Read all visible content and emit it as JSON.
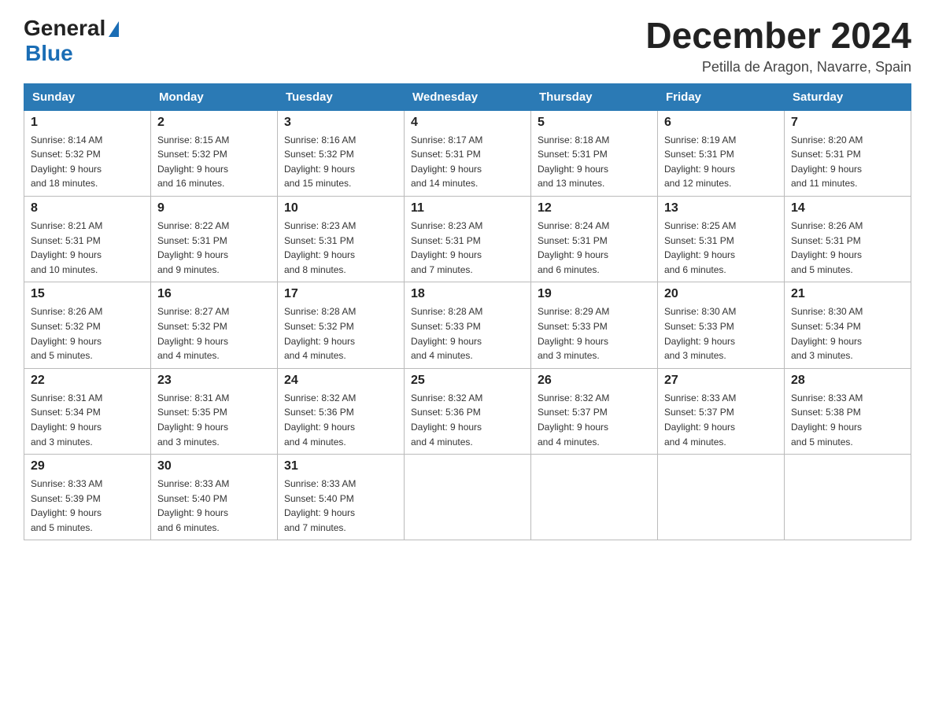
{
  "header": {
    "logo_general": "General",
    "logo_blue": "Blue",
    "month_title": "December 2024",
    "location": "Petilla de Aragon, Navarre, Spain"
  },
  "weekdays": [
    "Sunday",
    "Monday",
    "Tuesday",
    "Wednesday",
    "Thursday",
    "Friday",
    "Saturday"
  ],
  "weeks": [
    [
      {
        "day": "1",
        "sunrise": "8:14 AM",
        "sunset": "5:32 PM",
        "daylight": "9 hours and 18 minutes."
      },
      {
        "day": "2",
        "sunrise": "8:15 AM",
        "sunset": "5:32 PM",
        "daylight": "9 hours and 16 minutes."
      },
      {
        "day": "3",
        "sunrise": "8:16 AM",
        "sunset": "5:32 PM",
        "daylight": "9 hours and 15 minutes."
      },
      {
        "day": "4",
        "sunrise": "8:17 AM",
        "sunset": "5:31 PM",
        "daylight": "9 hours and 14 minutes."
      },
      {
        "day": "5",
        "sunrise": "8:18 AM",
        "sunset": "5:31 PM",
        "daylight": "9 hours and 13 minutes."
      },
      {
        "day": "6",
        "sunrise": "8:19 AM",
        "sunset": "5:31 PM",
        "daylight": "9 hours and 12 minutes."
      },
      {
        "day": "7",
        "sunrise": "8:20 AM",
        "sunset": "5:31 PM",
        "daylight": "9 hours and 11 minutes."
      }
    ],
    [
      {
        "day": "8",
        "sunrise": "8:21 AM",
        "sunset": "5:31 PM",
        "daylight": "9 hours and 10 minutes."
      },
      {
        "day": "9",
        "sunrise": "8:22 AM",
        "sunset": "5:31 PM",
        "daylight": "9 hours and 9 minutes."
      },
      {
        "day": "10",
        "sunrise": "8:23 AM",
        "sunset": "5:31 PM",
        "daylight": "9 hours and 8 minutes."
      },
      {
        "day": "11",
        "sunrise": "8:23 AM",
        "sunset": "5:31 PM",
        "daylight": "9 hours and 7 minutes."
      },
      {
        "day": "12",
        "sunrise": "8:24 AM",
        "sunset": "5:31 PM",
        "daylight": "9 hours and 6 minutes."
      },
      {
        "day": "13",
        "sunrise": "8:25 AM",
        "sunset": "5:31 PM",
        "daylight": "9 hours and 6 minutes."
      },
      {
        "day": "14",
        "sunrise": "8:26 AM",
        "sunset": "5:31 PM",
        "daylight": "9 hours and 5 minutes."
      }
    ],
    [
      {
        "day": "15",
        "sunrise": "8:26 AM",
        "sunset": "5:32 PM",
        "daylight": "9 hours and 5 minutes."
      },
      {
        "day": "16",
        "sunrise": "8:27 AM",
        "sunset": "5:32 PM",
        "daylight": "9 hours and 4 minutes."
      },
      {
        "day": "17",
        "sunrise": "8:28 AM",
        "sunset": "5:32 PM",
        "daylight": "9 hours and 4 minutes."
      },
      {
        "day": "18",
        "sunrise": "8:28 AM",
        "sunset": "5:33 PM",
        "daylight": "9 hours and 4 minutes."
      },
      {
        "day": "19",
        "sunrise": "8:29 AM",
        "sunset": "5:33 PM",
        "daylight": "9 hours and 3 minutes."
      },
      {
        "day": "20",
        "sunrise": "8:30 AM",
        "sunset": "5:33 PM",
        "daylight": "9 hours and 3 minutes."
      },
      {
        "day": "21",
        "sunrise": "8:30 AM",
        "sunset": "5:34 PM",
        "daylight": "9 hours and 3 minutes."
      }
    ],
    [
      {
        "day": "22",
        "sunrise": "8:31 AM",
        "sunset": "5:34 PM",
        "daylight": "9 hours and 3 minutes."
      },
      {
        "day": "23",
        "sunrise": "8:31 AM",
        "sunset": "5:35 PM",
        "daylight": "9 hours and 3 minutes."
      },
      {
        "day": "24",
        "sunrise": "8:32 AM",
        "sunset": "5:36 PM",
        "daylight": "9 hours and 4 minutes."
      },
      {
        "day": "25",
        "sunrise": "8:32 AM",
        "sunset": "5:36 PM",
        "daylight": "9 hours and 4 minutes."
      },
      {
        "day": "26",
        "sunrise": "8:32 AM",
        "sunset": "5:37 PM",
        "daylight": "9 hours and 4 minutes."
      },
      {
        "day": "27",
        "sunrise": "8:33 AM",
        "sunset": "5:37 PM",
        "daylight": "9 hours and 4 minutes."
      },
      {
        "day": "28",
        "sunrise": "8:33 AM",
        "sunset": "5:38 PM",
        "daylight": "9 hours and 5 minutes."
      }
    ],
    [
      {
        "day": "29",
        "sunrise": "8:33 AM",
        "sunset": "5:39 PM",
        "daylight": "9 hours and 5 minutes."
      },
      {
        "day": "30",
        "sunrise": "8:33 AM",
        "sunset": "5:40 PM",
        "daylight": "9 hours and 6 minutes."
      },
      {
        "day": "31",
        "sunrise": "8:33 AM",
        "sunset": "5:40 PM",
        "daylight": "9 hours and 7 minutes."
      },
      null,
      null,
      null,
      null
    ]
  ]
}
